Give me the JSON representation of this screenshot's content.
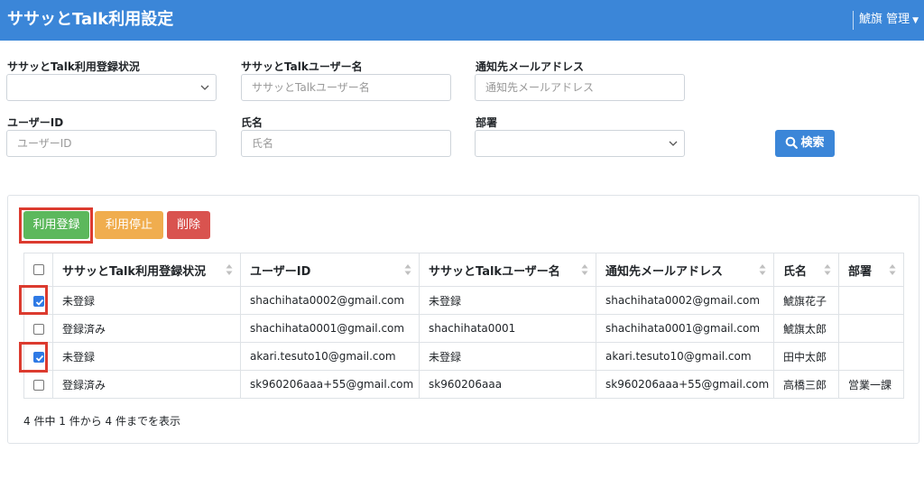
{
  "header": {
    "title": "ササッとTalk利用設定",
    "user_menu": "鯱旗 管理"
  },
  "filters": {
    "status": {
      "label": "ササッとTalk利用登録状況",
      "value": ""
    },
    "talk_user": {
      "label": "ササッとTalkユーザー名",
      "placeholder": "ササッとTalkユーザー名"
    },
    "email": {
      "label": "通知先メールアドレス",
      "placeholder": "通知先メールアドレス"
    },
    "user_id": {
      "label": "ユーザーID",
      "placeholder": "ユーザーID"
    },
    "name": {
      "label": "氏名",
      "placeholder": "氏名"
    },
    "dept": {
      "label": "部署",
      "value": ""
    },
    "search_label": "検索"
  },
  "actions": {
    "register": "利用登録",
    "stop": "利用停止",
    "delete": "削除"
  },
  "table": {
    "columns": [
      "ササッとTalk利用登録状況",
      "ユーザーID",
      "ササッとTalkユーザー名",
      "通知先メールアドレス",
      "氏名",
      "部署"
    ],
    "rows": [
      {
        "checked": true,
        "status": "未登録",
        "user_id": "shachihata0002@gmail.com",
        "talk_user": "未登録",
        "email": "shachihata0002@gmail.com",
        "name": "鯱旗花子",
        "dept": ""
      },
      {
        "checked": false,
        "status": "登録済み",
        "user_id": "shachihata0001@gmail.com",
        "talk_user": "shachihata0001",
        "email": "shachihata0001@gmail.com",
        "name": "鯱旗太郎",
        "dept": ""
      },
      {
        "checked": true,
        "status": "未登録",
        "user_id": "akari.tesuto10@gmail.com",
        "talk_user": "未登録",
        "email": "akari.tesuto10@gmail.com",
        "name": "田中太郎",
        "dept": ""
      },
      {
        "checked": false,
        "status": "登録済み",
        "user_id": "sk960206aaa+55@gmail.com",
        "talk_user": "sk960206aaa",
        "email": "sk960206aaa+55@gmail.com",
        "name": "高橋三郎",
        "dept": "営業一課"
      }
    ],
    "info": "4 件中 1 件から 4 件までを表示"
  },
  "colors": {
    "brand": "#3b86d8",
    "register": "#5cb85c",
    "stop": "#f0ad4e",
    "delete": "#d9534f",
    "highlight": "#dc3b2f"
  },
  "icons": {
    "search": "search-icon",
    "dropdown": "chevron-down-icon",
    "sort": "sort-icon"
  }
}
